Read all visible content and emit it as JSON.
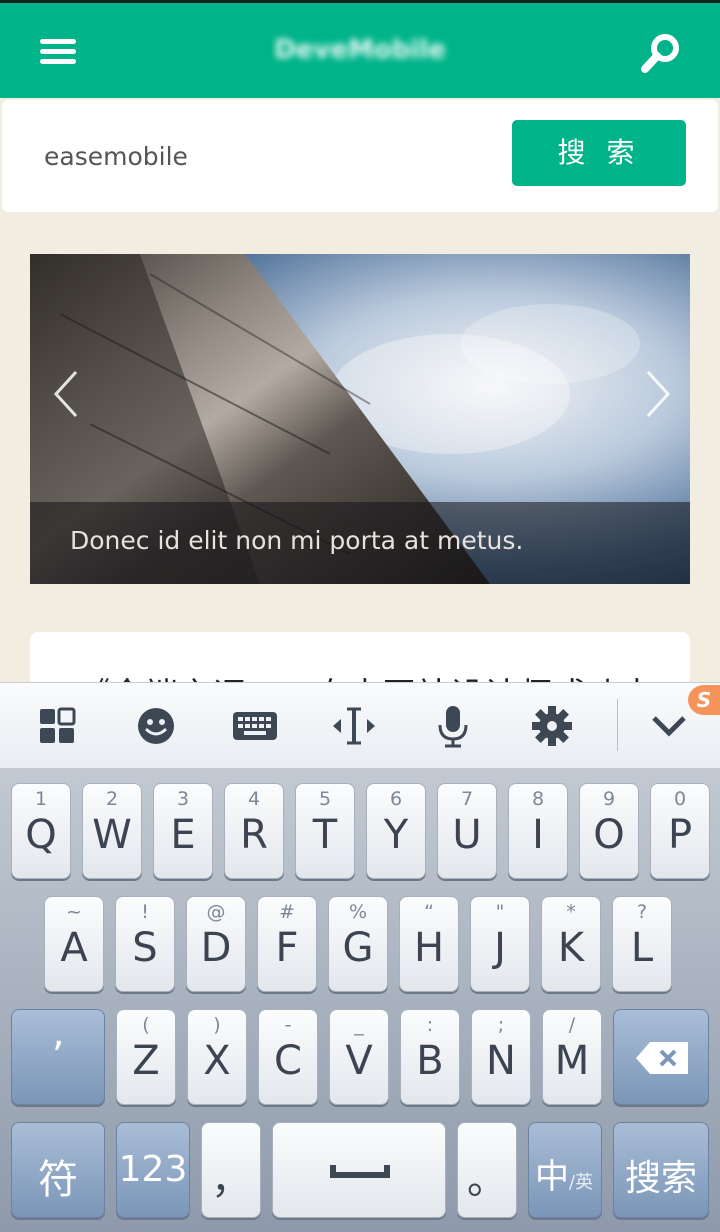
{
  "header": {
    "brand": "DeveMobile",
    "menu_icon": "hamburger-menu-icon",
    "search_icon": "search-icon",
    "accent": "#00b389"
  },
  "search": {
    "value": "easemobile",
    "button_label": "搜 索"
  },
  "carousel": {
    "caption": "Donec id elit non mi porta at metus.",
    "prev_icon": "chevron-left-icon",
    "next_icon": "chevron-right-icon"
  },
  "article": {
    "title": "《全端之词——自由网站设计师或功夫"
  },
  "keyboard_toolbar": {
    "icons": [
      "grid-icon",
      "emoji-icon",
      "keyboard-icon",
      "cursor-icon",
      "microphone-icon",
      "settings-gear-icon",
      "collapse-chevron-icon"
    ],
    "badge": "S"
  },
  "keyboard": {
    "row1": [
      {
        "sub": "1",
        "main": "Q"
      },
      {
        "sub": "2",
        "main": "W"
      },
      {
        "sub": "3",
        "main": "E"
      },
      {
        "sub": "4",
        "main": "R"
      },
      {
        "sub": "5",
        "main": "T"
      },
      {
        "sub": "6",
        "main": "Y"
      },
      {
        "sub": "7",
        "main": "U"
      },
      {
        "sub": "8",
        "main": "I"
      },
      {
        "sub": "9",
        "main": "O"
      },
      {
        "sub": "0",
        "main": "P"
      }
    ],
    "row2": [
      {
        "sub": "~",
        "main": "A"
      },
      {
        "sub": "!",
        "main": "S"
      },
      {
        "sub": "@",
        "main": "D"
      },
      {
        "sub": "#",
        "main": "F"
      },
      {
        "sub": "%",
        "main": "G"
      },
      {
        "sub": "“",
        "main": "H"
      },
      {
        "sub": "\"",
        "main": "J"
      },
      {
        "sub": "*",
        "main": "K"
      },
      {
        "sub": "?",
        "main": "L"
      }
    ],
    "row3": [
      {
        "sub": "(",
        "main": "Z"
      },
      {
        "sub": ")",
        "main": "X"
      },
      {
        "sub": "-",
        "main": "C"
      },
      {
        "sub": "_",
        "main": "V"
      },
      {
        "sub": ":",
        "main": "B"
      },
      {
        "sub": ";",
        "main": "N"
      },
      {
        "sub": "/",
        "main": "M"
      }
    ],
    "apostrophe": "’",
    "symbols": "符",
    "numbers": "123",
    "comma": "，",
    "period": "。",
    "lang_main": "中",
    "lang_sub": "/英",
    "search": "搜索",
    "delete_icon": "backspace-icon",
    "space_icon": "spacebar-icon"
  }
}
